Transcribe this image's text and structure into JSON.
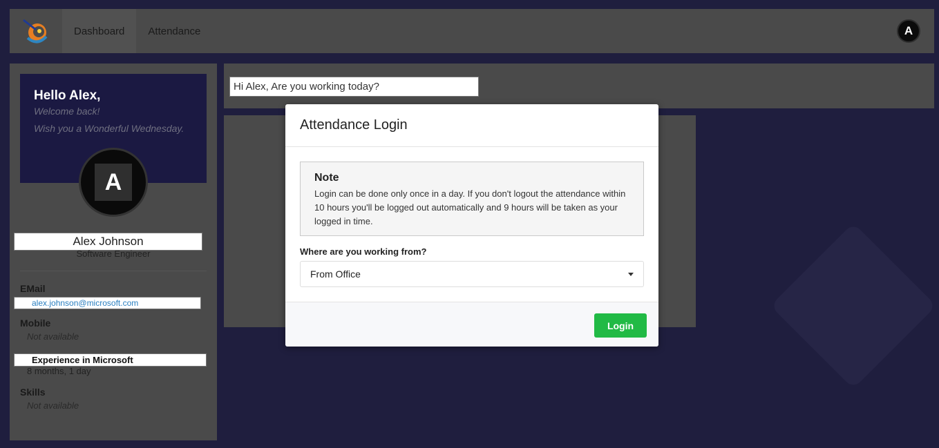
{
  "nav": {
    "items": [
      {
        "label": "Dashboard"
      },
      {
        "label": "Attendance"
      }
    ],
    "avatar_letter": "A"
  },
  "profile": {
    "hello": "Hello Alex,",
    "welcome": "Welcome back!",
    "wish": "Wish you a Wonderful Wednesday.",
    "avatar_letter": "A",
    "name": "Alex Johnson",
    "role": "Software Engineer",
    "fields": {
      "email_label": "EMail",
      "email_value": "alex.johnson@microsoft.com",
      "mobile_label": "Mobile",
      "mobile_value": "Not available",
      "experience_label": "Experience in Microsoft",
      "experience_value": "8 months, 1 day",
      "skills_label": "Skills",
      "skills_value": "Not available"
    }
  },
  "greeting": "Hi Alex, Are you working today?",
  "modal": {
    "title": "Attendance Login",
    "note_title": "Note",
    "note_text": "Login can be done only once in a day. If you don't logout the attendance within 10 hours you'll be logged out automatically and 9 hours will be taken as your logged in time.",
    "where_label": "Where are you working from?",
    "selected_option": "From Office",
    "login_label": "Login",
    "login_color": "#21ba45"
  }
}
